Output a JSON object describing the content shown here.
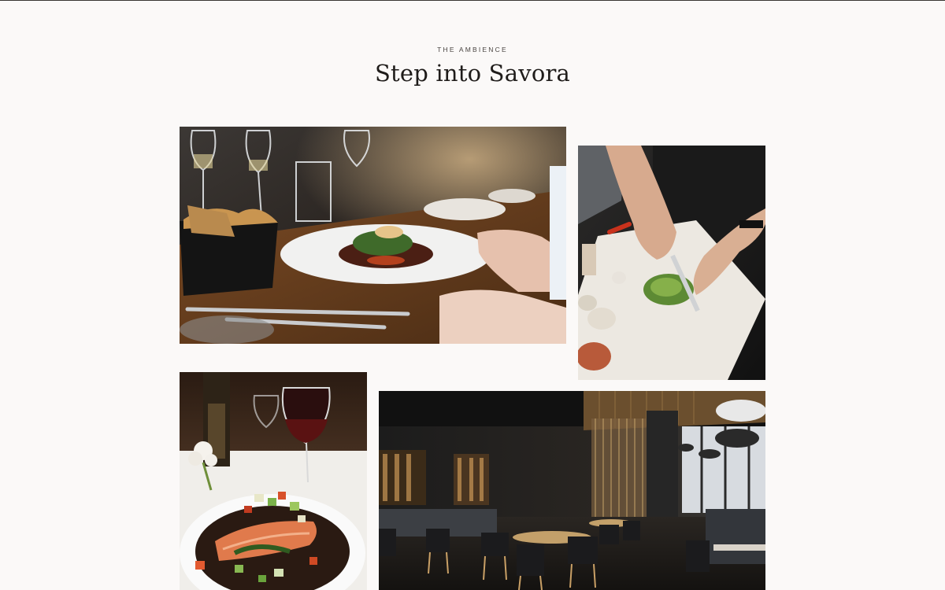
{
  "section": {
    "eyebrow": "THE AMBIENCE",
    "title": "Step into Savora"
  },
  "gallery": {
    "photos": [
      {
        "subject": "dining table with plated dish, wine glasses and bread basket"
      },
      {
        "subject": "chef chopping herbs on a cutting board"
      },
      {
        "subject": "salmon with vegetables and red wine"
      },
      {
        "subject": "restaurant interior with dark chairs and wooden slat walls"
      }
    ]
  },
  "colors": {
    "background": "#fbf9f8",
    "text": "#1f1c1a",
    "eyebrow": "#4a4542"
  }
}
